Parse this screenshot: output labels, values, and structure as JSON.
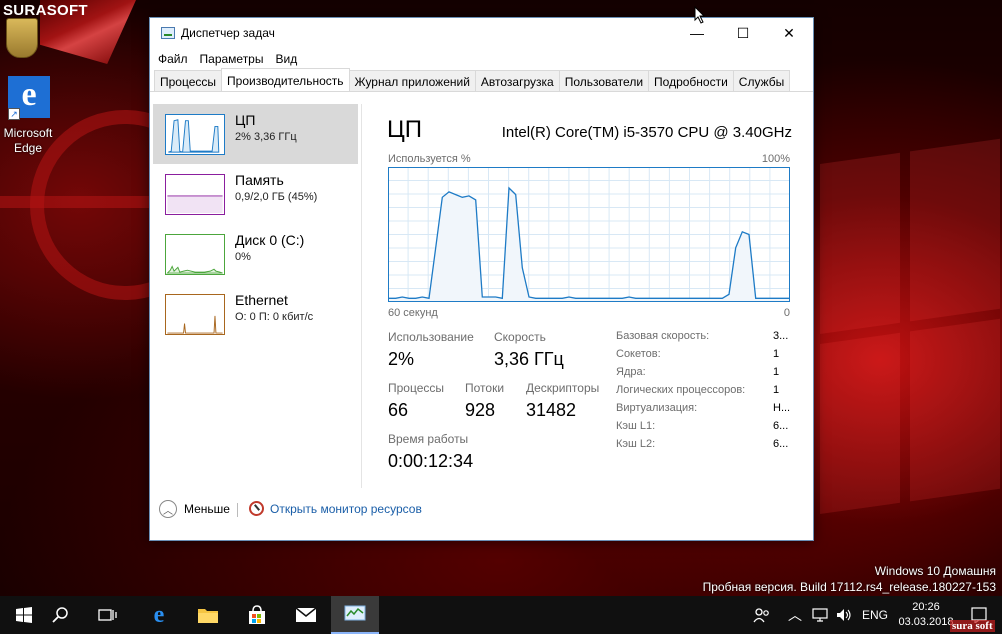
{
  "desktop": {
    "brand": "SURASOFT",
    "icons": [
      {
        "label": "Microsoft Edge",
        "icon": "edge-icon"
      }
    ],
    "watermark_line1": "Windows 10 Домашня",
    "watermark_line2": "Пробная версия. Build 17112.rs4_release.180227-153"
  },
  "window": {
    "title": "Диспетчер задач",
    "controls": {
      "minimize": "—",
      "maximize": "☐",
      "close": "✕"
    },
    "menu": [
      "Файл",
      "Параметры",
      "Вид"
    ],
    "tabs": [
      "Процессы",
      "Производительность",
      "Журнал приложений",
      "Автозагрузка",
      "Пользователи",
      "Подробности",
      "Службы"
    ],
    "active_tab": "Производительность"
  },
  "devices": [
    {
      "name": "ЦП",
      "sub": "2% 3,36 ГГц",
      "selected": true,
      "color": "#1e7bc6"
    },
    {
      "name": "Память",
      "sub": "0,9/2,0 ГБ (45%)",
      "selected": false,
      "color": "#8b1e9e"
    },
    {
      "name": "Диск 0 (C:)",
      "sub": "0%",
      "selected": false,
      "color": "#4ca63c"
    },
    {
      "name": "Ethernet",
      "sub": "О: 0 П: 0 кбит/с",
      "selected": false,
      "color": "#a8661e"
    }
  ],
  "cpu": {
    "title": "ЦП",
    "model": "Intel(R) Core(TM) i5-3570 CPU @ 3.40GHz",
    "graph_label_left": "Используется %",
    "graph_label_right": "100%",
    "graph_bottom_left": "60 секунд",
    "graph_bottom_right": "0",
    "usage_percent_series": [
      2,
      2,
      3,
      2,
      2,
      3,
      2,
      40,
      78,
      82,
      80,
      78,
      79,
      76,
      3,
      3,
      3,
      2,
      85,
      80,
      25,
      3,
      2,
      2,
      2,
      2,
      2,
      3,
      2,
      2,
      2,
      2,
      2,
      2,
      2,
      2,
      3,
      2,
      2,
      2,
      2,
      2,
      2,
      2,
      2,
      2,
      2,
      2,
      2,
      2,
      2,
      5,
      40,
      52,
      50,
      2,
      2,
      2,
      2,
      2,
      2
    ]
  },
  "stats": {
    "usage_label": "Использование",
    "usage_value": "2%",
    "speed_label": "Скорость",
    "speed_value": "3,36 ГГц",
    "processes_label": "Процессы",
    "processes_value": "66",
    "threads_label": "Потоки",
    "threads_value": "928",
    "handles_label": "Дескрипторы",
    "handles_value": "31482",
    "uptime_label": "Время работы",
    "uptime_value": "0:00:12:34"
  },
  "specs": [
    {
      "k": "Базовая скорость:",
      "v": "3..."
    },
    {
      "k": "Сокетов:",
      "v": "1"
    },
    {
      "k": "Ядра:",
      "v": "1"
    },
    {
      "k": "Логических процессоров:",
      "v": "1"
    },
    {
      "k": "Виртуализация:",
      "v": "Н..."
    },
    {
      "k": "Кэш L1:",
      "v": "6..."
    },
    {
      "k": "Кэш L2:",
      "v": "6..."
    }
  ],
  "footer": {
    "less_label": "Меньше",
    "monitor_link": "Открыть монитор ресурсов"
  },
  "taskbar": {
    "lang": "ENG",
    "time": "20:26",
    "date": "03.03.2018",
    "brand": "sura soft"
  }
}
